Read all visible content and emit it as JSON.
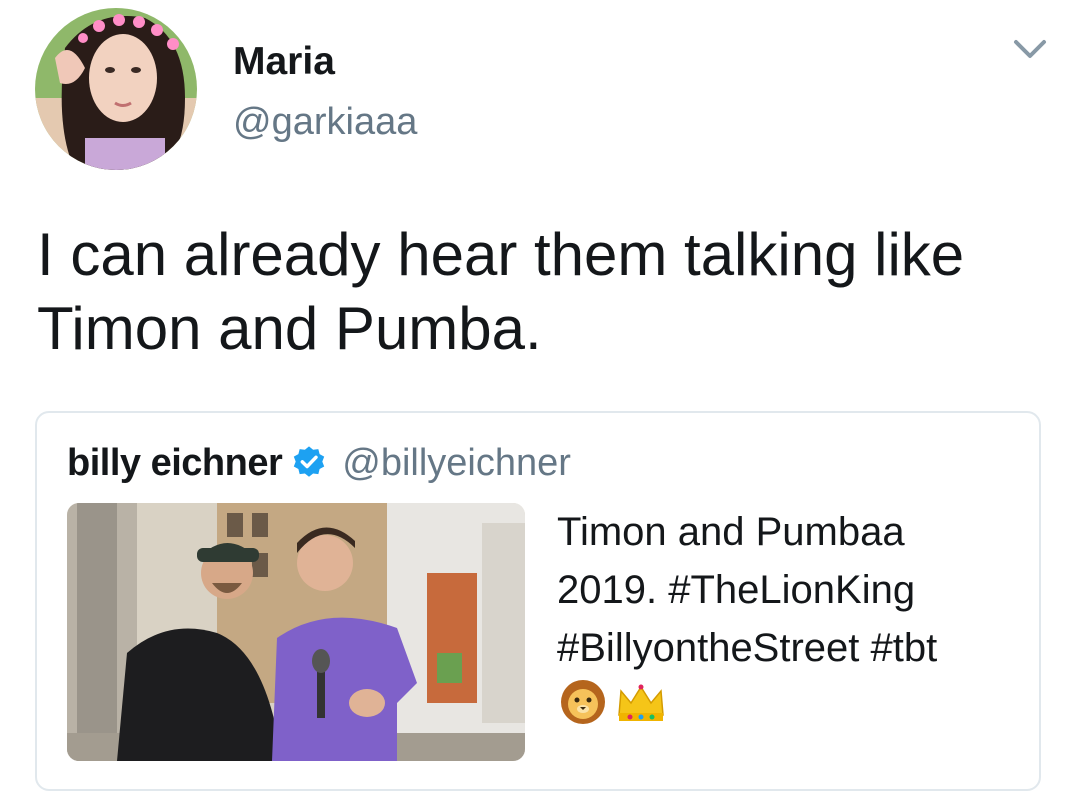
{
  "tweet": {
    "author": {
      "display_name": "Maria",
      "handle": "@garkiaaa"
    },
    "text": "I can already hear them talking like Timon and Pumba.",
    "menu_icon": "chevron-down-icon"
  },
  "quoted_tweet": {
    "author": {
      "display_name": "billy eichner",
      "handle": "@billyeichner",
      "verified": true
    },
    "text_lines": [
      "Timon and Pumbaa",
      "2019. #TheLionKing",
      "#BillyontheStreet #tbt"
    ],
    "emojis": [
      "lion-face-icon",
      "crown-icon"
    ]
  },
  "colors": {
    "text_primary": "#14171a",
    "text_secondary": "#657786",
    "verified_blue": "#1da1f2",
    "card_border": "#e1e8ed"
  }
}
